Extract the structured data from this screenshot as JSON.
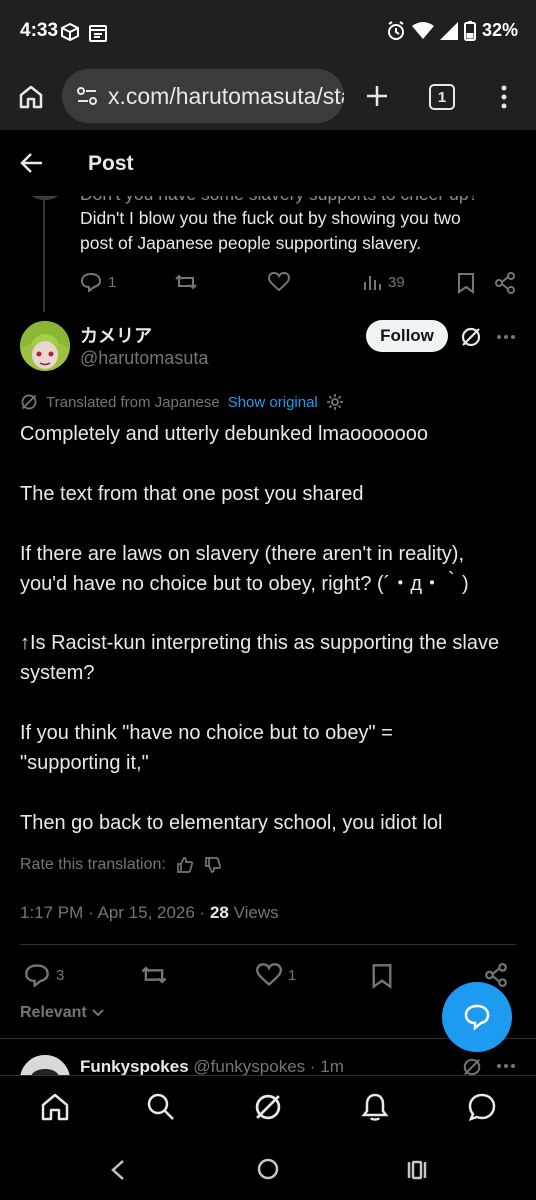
{
  "status_bar": {
    "time": "4:33",
    "battery": "32%"
  },
  "browser": {
    "url": "x.com/harutomasuta/sta",
    "tab_count": "1"
  },
  "header": {
    "title": "Post"
  },
  "previous_post": {
    "partial_line": "Don't you have some slavery supports to cheer up?",
    "text_line1": "Didn't I blow you the fuck out by showing you two",
    "text_line2": "post of Japanese people supporting slavery.",
    "replies": "1",
    "views": "39"
  },
  "post": {
    "author_name": "カメリア",
    "author_handle": "@harutomasuta",
    "follow_label": "Follow",
    "translated_label": "Translated from Japanese",
    "show_original_label": "Show original",
    "paragraphs": [
      "Completely and utterly debunked lmaooooooo",
      "The text from that one post you shared",
      "If there are laws on slavery (there aren't in reality), you'd have no choice but to obey, right? (´・д・｀)",
      "↑Is Racist-kun interpreting this as supporting the slave system?",
      "If you think \"have no choice but to obey\" = \"supporting it,\"",
      "Then go back to elementary school, you idiot lol"
    ],
    "rate_label": "Rate this translation:",
    "timestamp": "1:17 PM · Apr 15, 2026 · ",
    "views_count": "28",
    "views_label": " Views",
    "replies": "3",
    "likes": "1"
  },
  "sort": {
    "label": "Relevant"
  },
  "next_reply": {
    "author_name": "Funkyspokes",
    "handle_time": "@funkyspokes · 1m"
  }
}
